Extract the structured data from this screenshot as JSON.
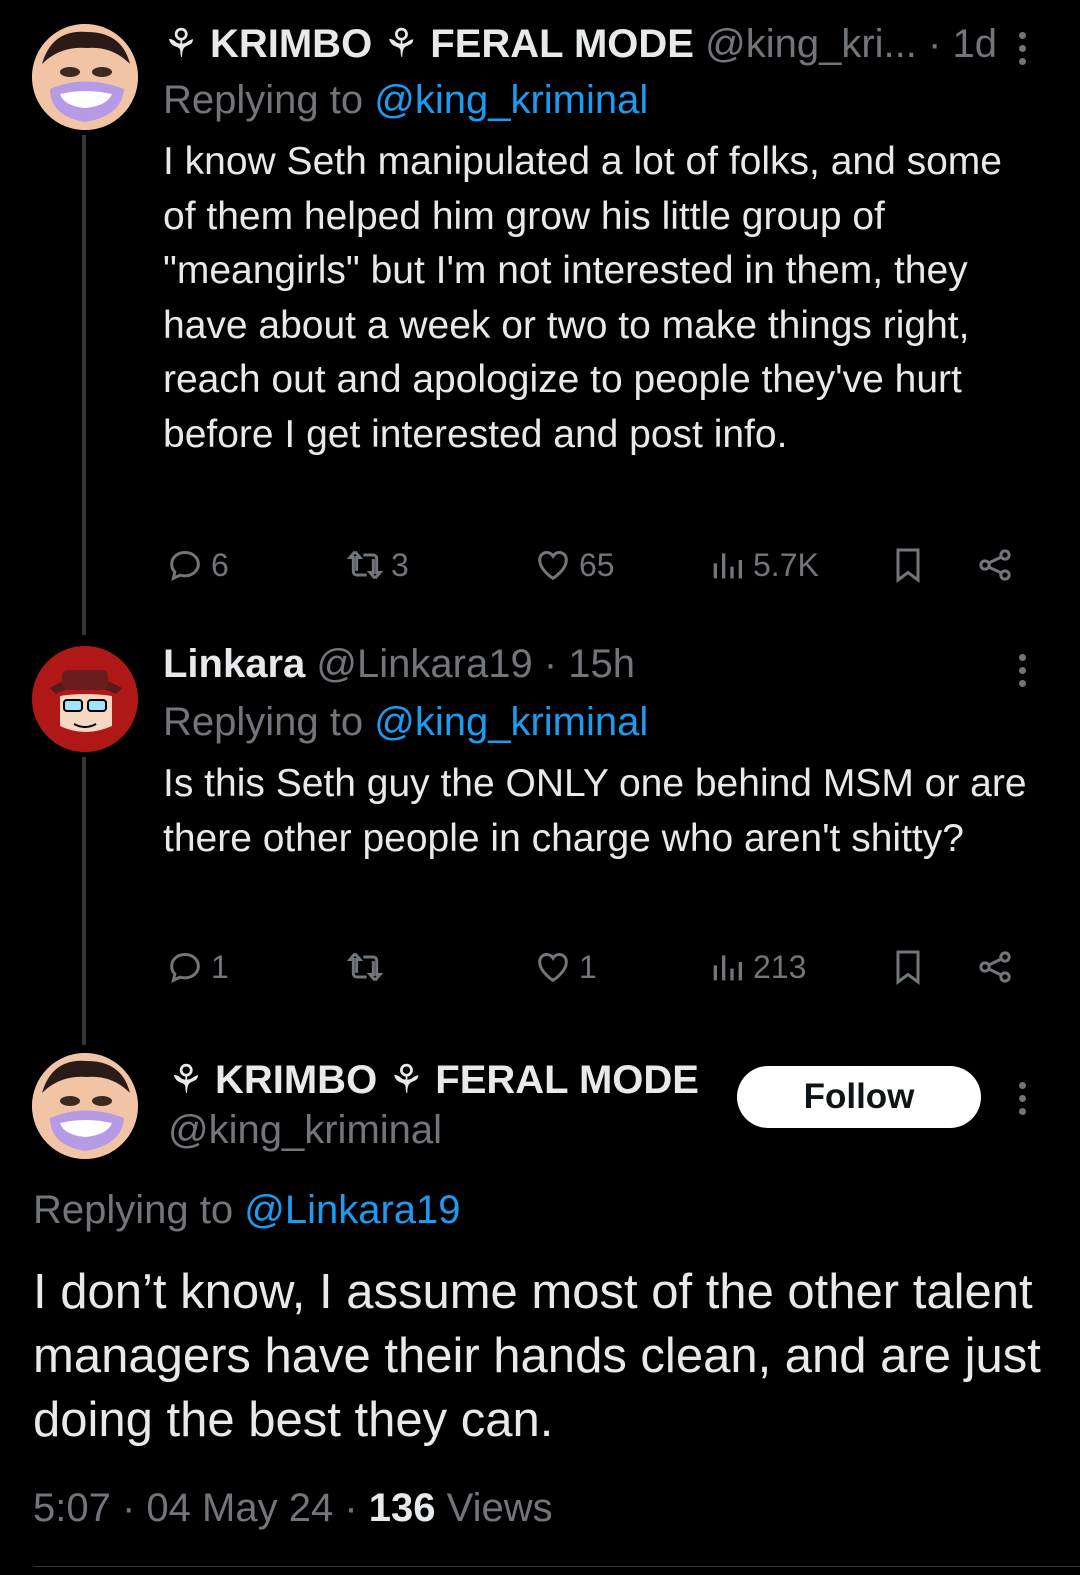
{
  "tweets": [
    {
      "display_name": "⚘ KRIMBO ⚘ FERAL MODE",
      "handle": "@king_kri...",
      "time": "· 1d",
      "replying_prefix": "Replying to ",
      "replying_to": "@king_kriminal",
      "text": "I know Seth manipulated a lot of folks, and some of them helped him grow his little group of \"meangirls\" but I'm not interested in them, they have about a week or two to make things right, reach out and apologize to people they've hurt before I get interested and post info.",
      "replies": "6",
      "retweets": "3",
      "likes": "65",
      "views": "5.7K"
    },
    {
      "display_name": "Linkara",
      "handle": "@Linkara19",
      "time": "· 15h",
      "replying_prefix": "Replying to ",
      "replying_to": "@king_kriminal",
      "text": "Is this Seth guy the ONLY one behind MSM or are there other people in charge who aren't shitty?",
      "replies": "1",
      "retweets": "",
      "likes": "1",
      "views": "213"
    }
  ],
  "main_tweet": {
    "display_name": "⚘ KRIMBO ⚘ FERAL MODE",
    "handle": "@king_kriminal",
    "follow_label": "Follow",
    "replying_prefix": "Replying to ",
    "replying_to": "@Linkara19",
    "text": "I don’t know, I assume most of the other talent managers have their hands clean, and are just doing the best they can.",
    "time": "5:07",
    "date": "04 May 24",
    "views_count": "136",
    "views_label": "Views"
  },
  "colors": {
    "background": "#000000",
    "text": "#e7e9ea",
    "secondary": "#71767b",
    "accent": "#1d9bf0"
  },
  "icons": [
    "reply-icon",
    "retweet-icon",
    "like-icon",
    "views-icon",
    "bookmark-icon",
    "share-icon",
    "more-icon"
  ]
}
